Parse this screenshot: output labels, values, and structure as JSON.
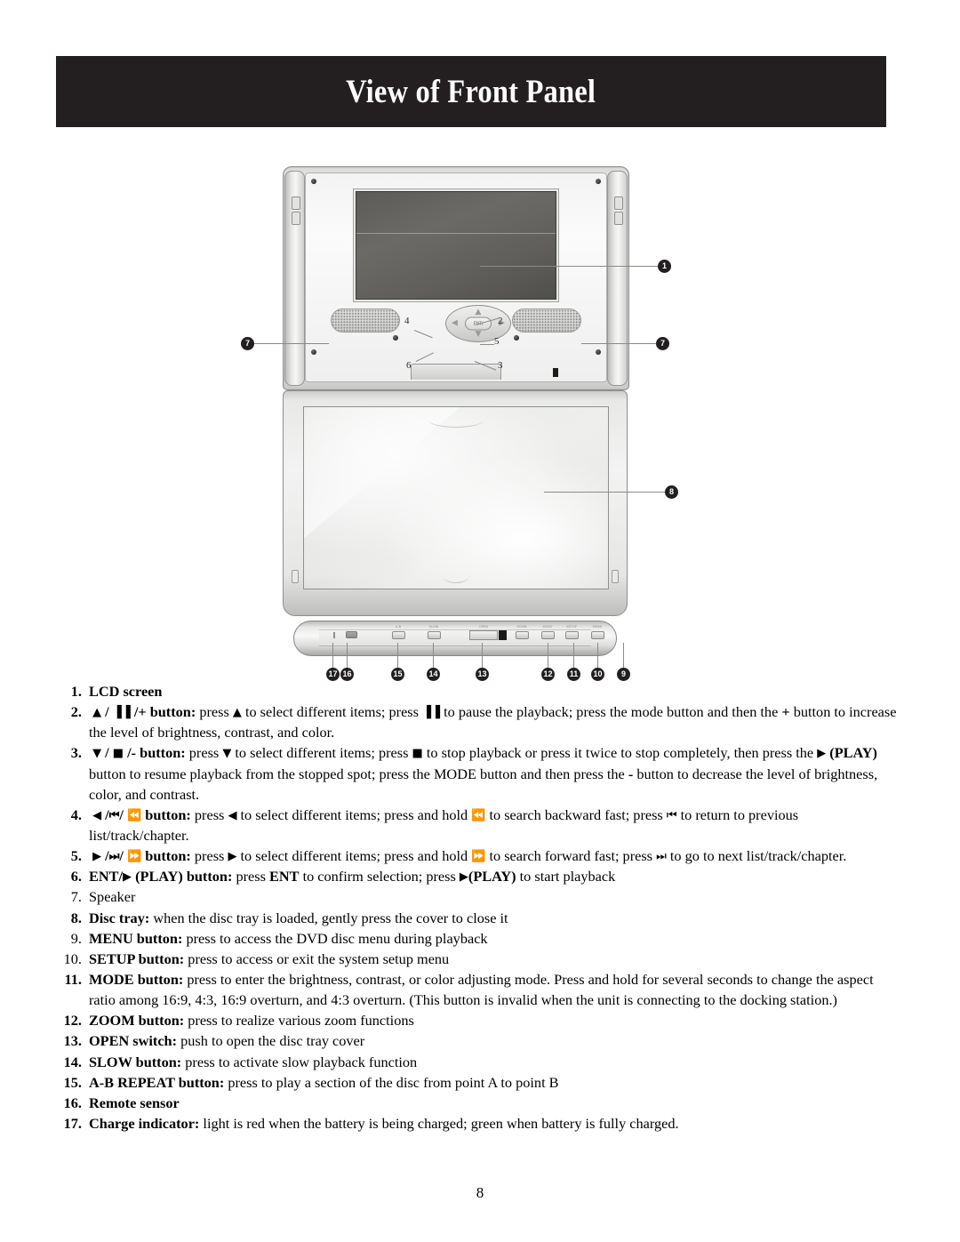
{
  "header": {
    "title": "View of Front Panel"
  },
  "figure": {
    "alt_name": "portable-dvd-player-front-panel",
    "dpad": {
      "center_label": "ENT/",
      "up_glyph": "▲",
      "down_glyph": "▼",
      "left_glyph": "◀",
      "right_glyph": "▶"
    },
    "strip_button_labels": [
      "A-B",
      "SLOW",
      "OPEN",
      "ZOOM",
      "MODE",
      "SETUP",
      "MENU"
    ],
    "callouts": [
      {
        "n": "1",
        "target": "lcd-screen"
      },
      {
        "n": "2",
        "target": "up-pause-plus-button"
      },
      {
        "n": "3",
        "target": "down-stop-minus-button"
      },
      {
        "n": "4",
        "target": "left-prev-rewind-button"
      },
      {
        "n": "5",
        "target": "right-next-forward-button"
      },
      {
        "n": "6",
        "target": "ent-play-button"
      },
      {
        "n": "7",
        "target": "speaker-left"
      },
      {
        "n": "7",
        "target": "speaker-right"
      },
      {
        "n": "8",
        "target": "disc-tray"
      },
      {
        "n": "9",
        "target": "menu-button"
      },
      {
        "n": "10",
        "target": "setup-button"
      },
      {
        "n": "11",
        "target": "mode-button"
      },
      {
        "n": "12",
        "target": "zoom-button"
      },
      {
        "n": "13",
        "target": "open-switch"
      },
      {
        "n": "14",
        "target": "slow-button"
      },
      {
        "n": "15",
        "target": "ab-repeat-button"
      },
      {
        "n": "16",
        "target": "remote-sensor"
      },
      {
        "n": "17",
        "target": "charge-indicator"
      }
    ]
  },
  "list": [
    {
      "num": "1.",
      "bold_num": true,
      "parts": [
        {
          "t": "LCD screen",
          "b": true
        }
      ]
    },
    {
      "num": "2.",
      "bold_num": true,
      "parts": [
        {
          "t": " ",
          "b": false
        },
        {
          "t": "▲",
          "b": true,
          "g": true
        },
        {
          "t": " / ",
          "b": true
        },
        {
          "t": "▐▐",
          "b": true,
          "g": true
        },
        {
          "t": " /+ button:",
          "b": true
        },
        {
          "t": " press ",
          "b": false
        },
        {
          "t": "▲",
          "b": false,
          "g": true
        },
        {
          "t": " to select different items; press ",
          "b": false
        },
        {
          "t": "▐▐",
          "b": false,
          "g": true
        },
        {
          "t": " to pause the playback; press the mode button and then the ",
          "b": false
        },
        {
          "t": "+",
          "b": true
        },
        {
          "t": " button to increase the level of brightness, contrast, and color.",
          "b": false
        }
      ]
    },
    {
      "num": "3.",
      "bold_num": true,
      "parts": [
        {
          "t": " ",
          "b": false
        },
        {
          "t": "▼",
          "b": true,
          "g": true
        },
        {
          "t": " / ",
          "b": true
        },
        {
          "t": "■",
          "b": true,
          "g": true
        },
        {
          "t": " /- button:",
          "b": true
        },
        {
          "t": " press ",
          "b": false
        },
        {
          "t": "▼",
          "b": false,
          "g": true
        },
        {
          "t": " to select different items; press ",
          "b": false
        },
        {
          "t": "■",
          "b": false,
          "g": true
        },
        {
          "t": " to stop playback or press it twice to stop completely, then press the ",
          "b": false
        },
        {
          "t": "▶",
          "b": false,
          "g": true
        },
        {
          "t": " (PLAY)",
          "b": true
        },
        {
          "t": " button to resume playback from the stopped spot; press the MODE button and then press the ",
          "b": false
        },
        {
          "t": "-",
          "b": true
        },
        {
          "t": " button to decrease the level of brightness, color, and contrast.",
          "b": false
        }
      ]
    },
    {
      "num": "4.",
      "bold_num": true,
      "parts": [
        {
          "t": " ",
          "b": false
        },
        {
          "t": "◀",
          "b": true,
          "g": true
        },
        {
          "t": " /",
          "b": true
        },
        {
          "t": "⏮",
          "b": true,
          "g": true
        },
        {
          "t": "/ ",
          "b": true
        },
        {
          "t": "⏪",
          "b": true,
          "g": true
        },
        {
          "t": " button:",
          "b": true
        },
        {
          "t": " press ",
          "b": false
        },
        {
          "t": "◀",
          "b": false,
          "g": true
        },
        {
          "t": " to select different items; press and hold ",
          "b": false
        },
        {
          "t": "⏪",
          "b": false,
          "g": true
        },
        {
          "t": " to search backward fast; press ",
          "b": false
        },
        {
          "t": "⏮",
          "b": false,
          "g": true
        },
        {
          "t": " to return to previous list/track/chapter.",
          "b": false
        }
      ]
    },
    {
      "num": "5.",
      "bold_num": true,
      "parts": [
        {
          "t": " ",
          "b": false
        },
        {
          "t": "▶",
          "b": true,
          "g": true
        },
        {
          "t": " /",
          "b": true
        },
        {
          "t": "⏭",
          "b": true,
          "g": true
        },
        {
          "t": "/ ",
          "b": true
        },
        {
          "t": "⏩",
          "b": true,
          "g": true
        },
        {
          "t": " button:",
          "b": true
        },
        {
          "t": " press ",
          "b": false
        },
        {
          "t": "▶",
          "b": false,
          "g": true
        },
        {
          "t": " to select different items; press and hold ",
          "b": false
        },
        {
          "t": "⏩",
          "b": false,
          "g": true
        },
        {
          "t": " to search forward fast; press ",
          "b": false
        },
        {
          "t": "⏭",
          "b": false,
          "g": true
        },
        {
          "t": " to go to next list/track/chapter.",
          "b": false
        }
      ]
    },
    {
      "num": "6.",
      "bold_num": true,
      "parts": [
        {
          "t": "ENT/",
          "b": true
        },
        {
          "t": "▶",
          "b": true,
          "g": true
        },
        {
          "t": " (PLAY) button:",
          "b": true
        },
        {
          "t": " press ",
          "b": false
        },
        {
          "t": "ENT",
          "b": true
        },
        {
          "t": " to confirm selection; press ",
          "b": false
        },
        {
          "t": "▶",
          "b": false,
          "g": true
        },
        {
          "t": "(PLAY)",
          "b": true
        },
        {
          "t": " to start playback",
          "b": false
        }
      ]
    },
    {
      "num": "7.",
      "bold_num": false,
      "parts": [
        {
          "t": "Speaker",
          "b": false
        }
      ]
    },
    {
      "num": "8.",
      "bold_num": true,
      "parts": [
        {
          "t": "Disc tray:",
          "b": true
        },
        {
          "t": " when the disc tray is loaded, gently press the cover to close it",
          "b": false
        }
      ]
    },
    {
      "num": "9.",
      "bold_num": false,
      "parts": [
        {
          "t": "MENU button:",
          "b": true
        },
        {
          "t": " press to access the DVD disc menu during playback",
          "b": false
        }
      ]
    },
    {
      "num": "10.",
      "bold_num": false,
      "parts": [
        {
          "t": "SETUP button:",
          "b": true
        },
        {
          "t": " press to access or exit the system setup menu",
          "b": false
        }
      ]
    },
    {
      "num": "11.",
      "bold_num": true,
      "parts": [
        {
          "t": "MODE button:",
          "b": true
        },
        {
          "t": " press to enter the brightness, contrast, or color adjusting mode.  Press and hold for several seconds to change the aspect ratio among 16:9, 4:3, 16:9 overturn, and 4:3 overturn. (This button is invalid when the unit is connecting to the docking station.)",
          "b": false
        }
      ]
    },
    {
      "num": "12.",
      "bold_num": true,
      "parts": [
        {
          "t": "ZOOM button:",
          "b": true
        },
        {
          "t": " press to realize various zoom functions",
          "b": false
        }
      ]
    },
    {
      "num": "13.",
      "bold_num": true,
      "parts": [
        {
          "t": "OPEN switch:",
          "b": true
        },
        {
          "t": " push to open the disc tray cover",
          "b": false
        }
      ]
    },
    {
      "num": "14.",
      "bold_num": true,
      "parts": [
        {
          "t": "SLOW button:",
          "b": true
        },
        {
          "t": " press to activate slow playback function",
          "b": false
        }
      ]
    },
    {
      "num": "15.",
      "bold_num": true,
      "parts": [
        {
          "t": "A-B REPEAT button:",
          "b": true
        },
        {
          "t": " press to play a section of the disc from point A to point B",
          "b": false
        }
      ]
    },
    {
      "num": "16.",
      "bold_num": true,
      "parts": [
        {
          "t": "Remote sensor",
          "b": true
        }
      ]
    },
    {
      "num": "17.",
      "bold_num": true,
      "parts": [
        {
          "t": "Charge indicator:",
          "b": true
        },
        {
          "t": " light is red when the battery is being charged; green when battery is fully charged.",
          "b": false
        }
      ]
    }
  ],
  "footer": {
    "page_number": "8"
  },
  "colors": {
    "banner_bg": "#231f20",
    "banner_text": "#ffffff",
    "callout_bg": "#231f20",
    "leader_line": "#8a8c89"
  }
}
